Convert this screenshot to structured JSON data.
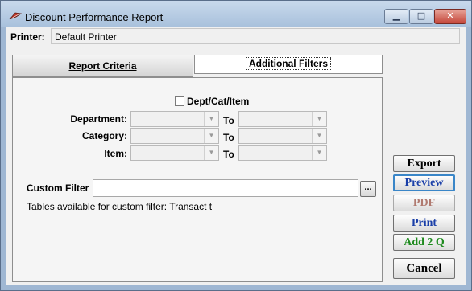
{
  "window": {
    "title": "Discount Performance Report",
    "controls": {
      "minimize": "▁",
      "maximize": "□",
      "close": "✕"
    }
  },
  "printer": {
    "label": "Printer:",
    "value": "Default Printer"
  },
  "tabs": [
    {
      "label": "Report Criteria",
      "active": false
    },
    {
      "label": "Additional Filters",
      "active": true
    }
  ],
  "filters": {
    "dept_cat_item_label": "Dept/Cat/Item",
    "dept_cat_item_checked": false,
    "to_label": "To",
    "rows": [
      {
        "label": "Department:"
      },
      {
        "label": "Category:"
      },
      {
        "label": "Item:"
      }
    ],
    "custom_filter_label": "Custom Filter",
    "custom_filter_value": "",
    "ellipsis_label": "...",
    "tables_note": "Tables available for custom filter: Transact t"
  },
  "side_buttons": {
    "export": "Export",
    "preview": "Preview",
    "pdf": "PDF",
    "print": "Print",
    "add2q": "Add 2 Q",
    "cancel": "Cancel"
  },
  "icons": {
    "app": "feather-logo-icon",
    "dropdown": "chevron-down-icon"
  },
  "colors": {
    "desktop": "#c4332e",
    "preview_text": "#1a3fa8",
    "add2q_text": "#1e8a1e",
    "pdf_text": "#b07a70"
  }
}
